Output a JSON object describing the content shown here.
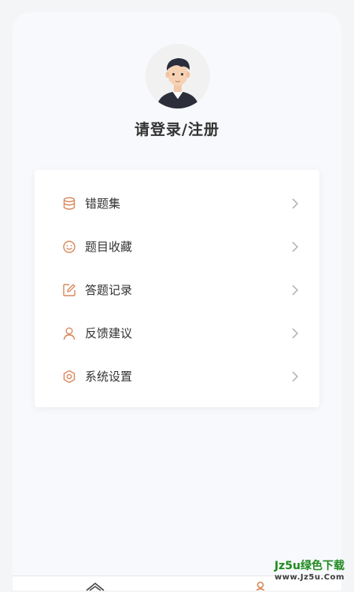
{
  "profile": {
    "login_text": "请登录/注册"
  },
  "menu": {
    "items": [
      {
        "label": "错题集",
        "icon": "database-icon"
      },
      {
        "label": "题目收藏",
        "icon": "smile-icon"
      },
      {
        "label": "答题记录",
        "icon": "edit-icon"
      },
      {
        "label": "反馈建议",
        "icon": "user-icon"
      },
      {
        "label": "系统设置",
        "icon": "settings-icon"
      }
    ]
  },
  "colors": {
    "accent": "#d9875a",
    "chevron": "#b0b0b0"
  },
  "watermark": {
    "brand": "Jz5u绿色下载",
    "url": "www.Jz5u.Com"
  }
}
